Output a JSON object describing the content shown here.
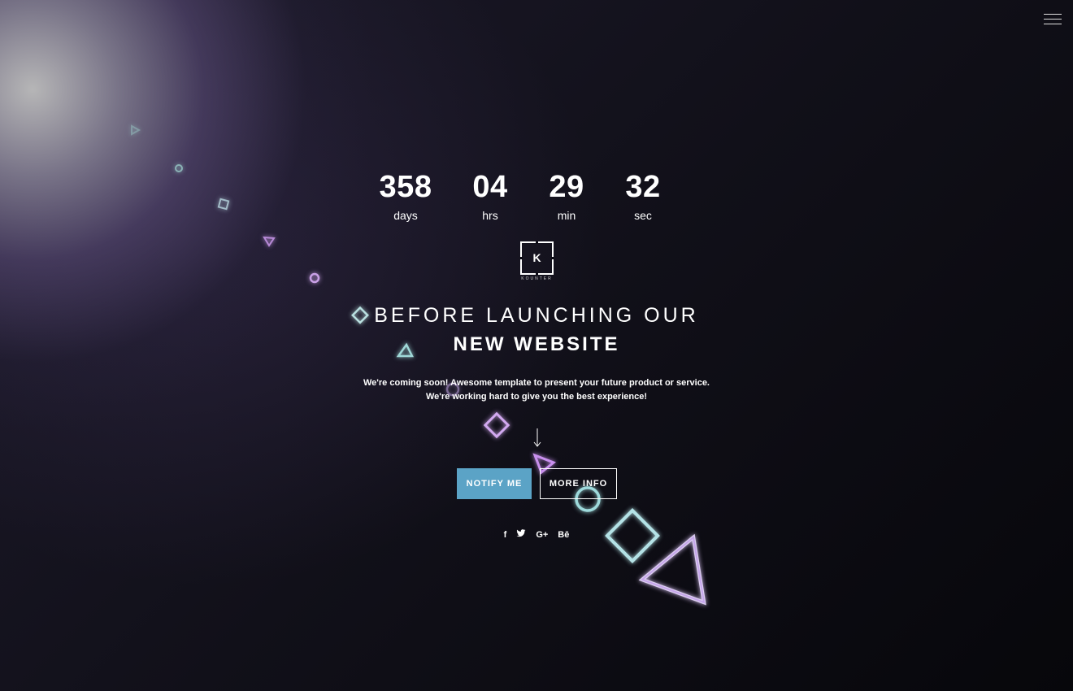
{
  "countdown": [
    {
      "value": "358",
      "label": "days"
    },
    {
      "value": "04",
      "label": "hrs"
    },
    {
      "value": "29",
      "label": "min"
    },
    {
      "value": "32",
      "label": "sec"
    }
  ],
  "logo": {
    "letter": "K",
    "name": "KOUNTER"
  },
  "headline": {
    "line1": "BEFORE LAUNCHING OUR",
    "line2": "NEW WEBSITE"
  },
  "description": {
    "line1": "We're coming soon! Awesome template to present your future product or service.",
    "line2": "We're working hard to give you the best experience!"
  },
  "buttons": {
    "notify": "NOTIFY ME",
    "more": "MORE INFO"
  },
  "social": {
    "facebook": "f",
    "twitter": "🐦",
    "google": "G+",
    "behance": "Bē"
  },
  "colors": {
    "accent": "#5ba3c6",
    "background": "#0c0b14"
  },
  "icons": {
    "menu": "hamburger-menu-icon",
    "scroll": "arrow-down-icon"
  }
}
